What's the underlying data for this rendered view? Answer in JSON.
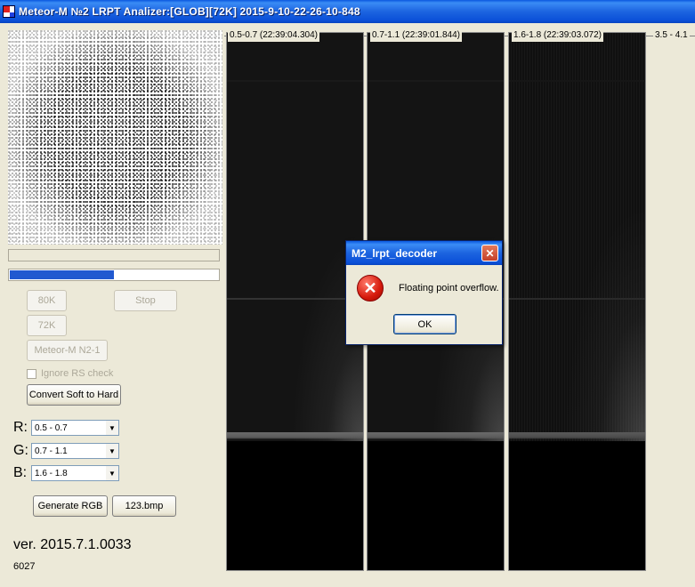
{
  "window": {
    "title": "Meteor-M №2 LRPT Analizer:[GLOB][72K] 2015-9-10-22-26-10-848"
  },
  "left_panel": {
    "progress_fraction": 0.5,
    "buttons": {
      "btn_80k": "80K",
      "btn_stop": "Stop",
      "btn_72k": "72K",
      "btn_meteor": "Meteor-M N2-1",
      "btn_convert": "Convert Soft to Hard",
      "btn_generate": "Generate RGB",
      "btn_bmp": "123.bmp"
    },
    "ignore_rs_label": "Ignore RS check",
    "rgb": [
      {
        "label": "R:",
        "value": "0.5 - 0.7"
      },
      {
        "label": "G:",
        "value": "0.7 - 1.1"
      },
      {
        "label": "B:",
        "value": "1.6 - 1.8"
      }
    ],
    "version": "ver. 2015.7.1.0033",
    "build": "6027"
  },
  "channels": [
    {
      "label": "0.5-0.7 (22:39:04.304)"
    },
    {
      "label": "0.7-1.1 (22:39:01.844)"
    },
    {
      "label": "1.6-1.8 (22:39:03.072)"
    },
    {
      "label": "3.5 - 4.1"
    }
  ],
  "dialog": {
    "title": "M2_lrpt_decoder",
    "close_glyph": "✕",
    "icon_glyph": "✕",
    "message": "Floating point overflow.",
    "ok_label": "OK"
  },
  "colors": {
    "titlebar": "#0b50d8",
    "progress": "#2159d0",
    "error_icon": "#d61a0c"
  }
}
